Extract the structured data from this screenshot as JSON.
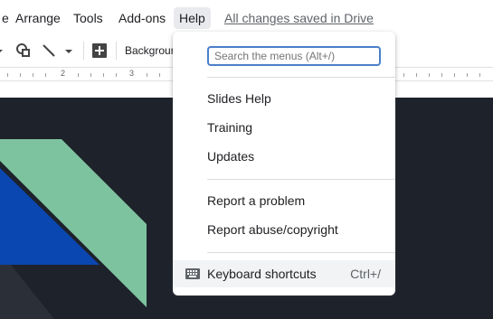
{
  "menubar": {
    "items": [
      {
        "label": "e",
        "active": false
      },
      {
        "label": "Arrange",
        "active": false
      },
      {
        "label": "Tools",
        "active": false
      },
      {
        "label": "Add-ons",
        "active": false
      },
      {
        "label": "Help",
        "active": true
      }
    ],
    "saved_status": "All changes saved in Drive"
  },
  "toolbar": {
    "background_label": "Backgrour"
  },
  "ruler": {
    "numbers": [
      "2",
      "3"
    ]
  },
  "help_menu": {
    "search_placeholder": "Search the menus (Alt+/)",
    "items": [
      {
        "label": "Slides Help"
      },
      {
        "label": "Training"
      },
      {
        "label": "Updates"
      },
      {
        "label": "Report a problem"
      },
      {
        "label": "Report abuse/copyright"
      },
      {
        "label": "Keyboard shortcuts",
        "shortcut": "Ctrl+/",
        "icon": "keyboard-icon"
      }
    ]
  },
  "colors": {
    "slide_background": "#1e222b",
    "green_shape": "#7ec3a0",
    "blue_shape": "#0a47b0",
    "accent": "#4a7fc9"
  }
}
